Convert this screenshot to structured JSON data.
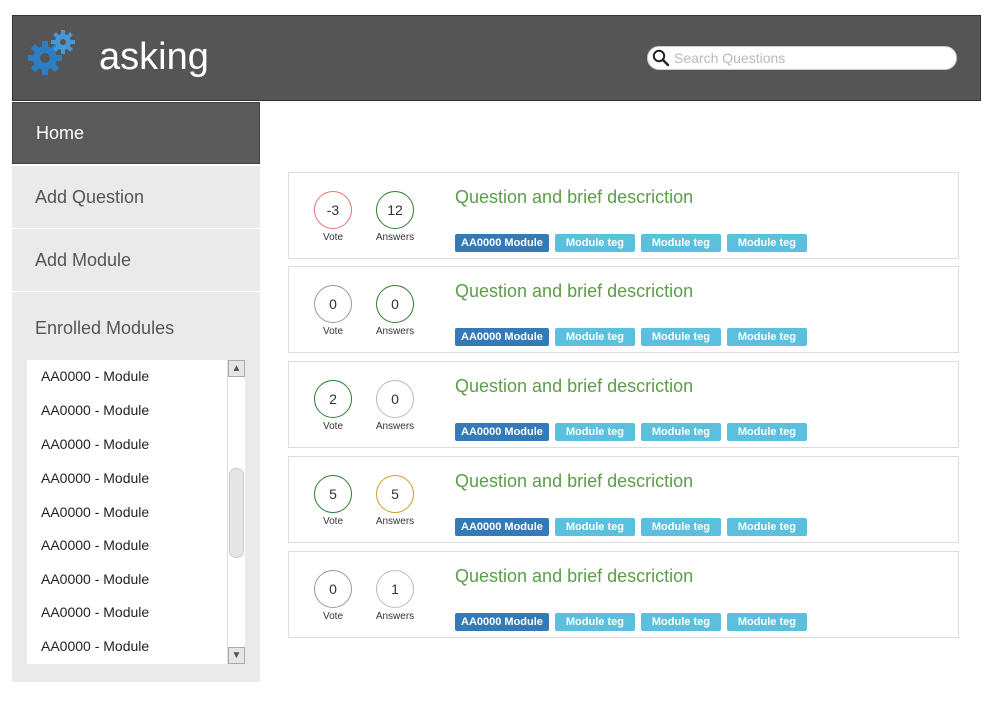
{
  "header": {
    "title": "asking",
    "logo_icon": "gears-icon",
    "search_placeholder": "Search Questions",
    "search_icon": "search-icon"
  },
  "sidebar": {
    "nav": [
      {
        "label": "Home",
        "active": true
      },
      {
        "label": "Add Question"
      },
      {
        "label": "Add Module"
      }
    ],
    "enrolled_title": "Enrolled Modules",
    "modules": [
      "AA0000 - Module",
      "AA0000 - Module",
      "AA0000 - Module",
      "AA0000 - Module",
      "AA0000 - Module",
      "AA0000 - Module",
      "AA0000 - Module",
      "AA0000 - Module",
      "AA0000 - Module"
    ]
  },
  "questions": [
    {
      "votes": "-3",
      "answers": "12",
      "vote_label": "Vote",
      "answers_label": "Answers",
      "title": "Question and brief descriction",
      "module_tag": "AA0000 Module",
      "tags": [
        "Module teg",
        "Module teg",
        "Module teg"
      ],
      "vote_color": "#e57373",
      "answers_color": "#2e7d32"
    },
    {
      "votes": "0",
      "answers": "0",
      "vote_label": "Vote",
      "answers_label": "Answers",
      "title": "Question and brief descriction",
      "module_tag": "AA0000 Module",
      "tags": [
        "Module teg",
        "Module teg",
        "Module teg"
      ],
      "vote_color": "#999999",
      "answers_color": "#2e7d32"
    },
    {
      "votes": "2",
      "answers": "0",
      "vote_label": "Vote",
      "answers_label": "Answers",
      "title": "Question and brief descriction",
      "module_tag": "AA0000 Module",
      "tags": [
        "Module teg",
        "Module teg",
        "Module teg"
      ],
      "vote_color": "#2e7d32",
      "answers_color": "#bbbbbb"
    },
    {
      "votes": "5",
      "answers": "5",
      "vote_label": "Vote",
      "answers_label": "Answers",
      "title": "Question and brief descriction",
      "module_tag": "AA0000 Module",
      "tags": [
        "Module teg",
        "Module teg",
        "Module teg"
      ],
      "vote_color": "#2e7d32",
      "answers_color": "#c9a227"
    },
    {
      "votes": "0",
      "answers": "1",
      "vote_label": "Vote",
      "answers_label": "Answers",
      "title": "Question and brief descriction",
      "module_tag": "AA0000 Module",
      "tags": [
        "Module teg",
        "Module teg",
        "Module teg"
      ],
      "vote_color": "#999999",
      "answers_color": "#bbbbbb"
    }
  ],
  "colors": {
    "header_bg": "#555555",
    "question_title": "#5a9e47",
    "module_tag": "#337ab7",
    "teg_tag": "#5bc0de"
  }
}
